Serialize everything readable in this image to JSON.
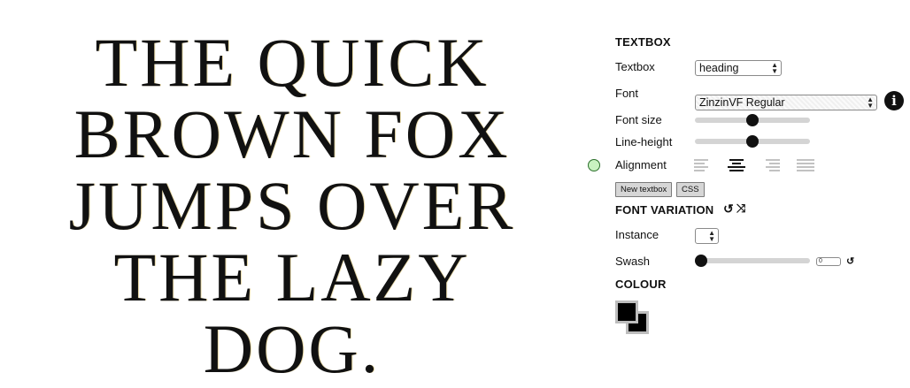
{
  "preview": {
    "lines": [
      "THE QUICK",
      "BROWN FOX",
      "JUMPS OVER",
      "THE LAZY",
      "DOG."
    ]
  },
  "textbox_section": {
    "heading": "TEXTBOX",
    "textbox_label": "Textbox",
    "textbox_value": "heading",
    "font_label": "Font",
    "font_value": "ZinzinVF Regular",
    "info_icon": "info-icon",
    "font_size_label": "Font size",
    "font_size_level": 0.5,
    "line_height_label": "Line-height",
    "line_height_level": 0.5,
    "alignment_label": "Alignment",
    "alignment_options": [
      "left",
      "center",
      "right",
      "justify"
    ],
    "alignment_selected": "center",
    "new_textbox_label": "New textbox",
    "css_label": "CSS"
  },
  "font_variation_section": {
    "heading": "FONT VARIATION",
    "reset_icon": "reset-icon",
    "shuffle_icon": "shuffle-icon",
    "instance_label": "Instance",
    "instance_value": "",
    "swash_label": "Swash",
    "swash_value": "0",
    "swash_level": 0
  },
  "colour_section": {
    "heading": "COLOUR",
    "foreground": "#000000",
    "background": "#000000"
  },
  "colors": {
    "status_dot": "#c9f2c1",
    "slider_track": "#d4d4d4",
    "knob": "#111111"
  }
}
